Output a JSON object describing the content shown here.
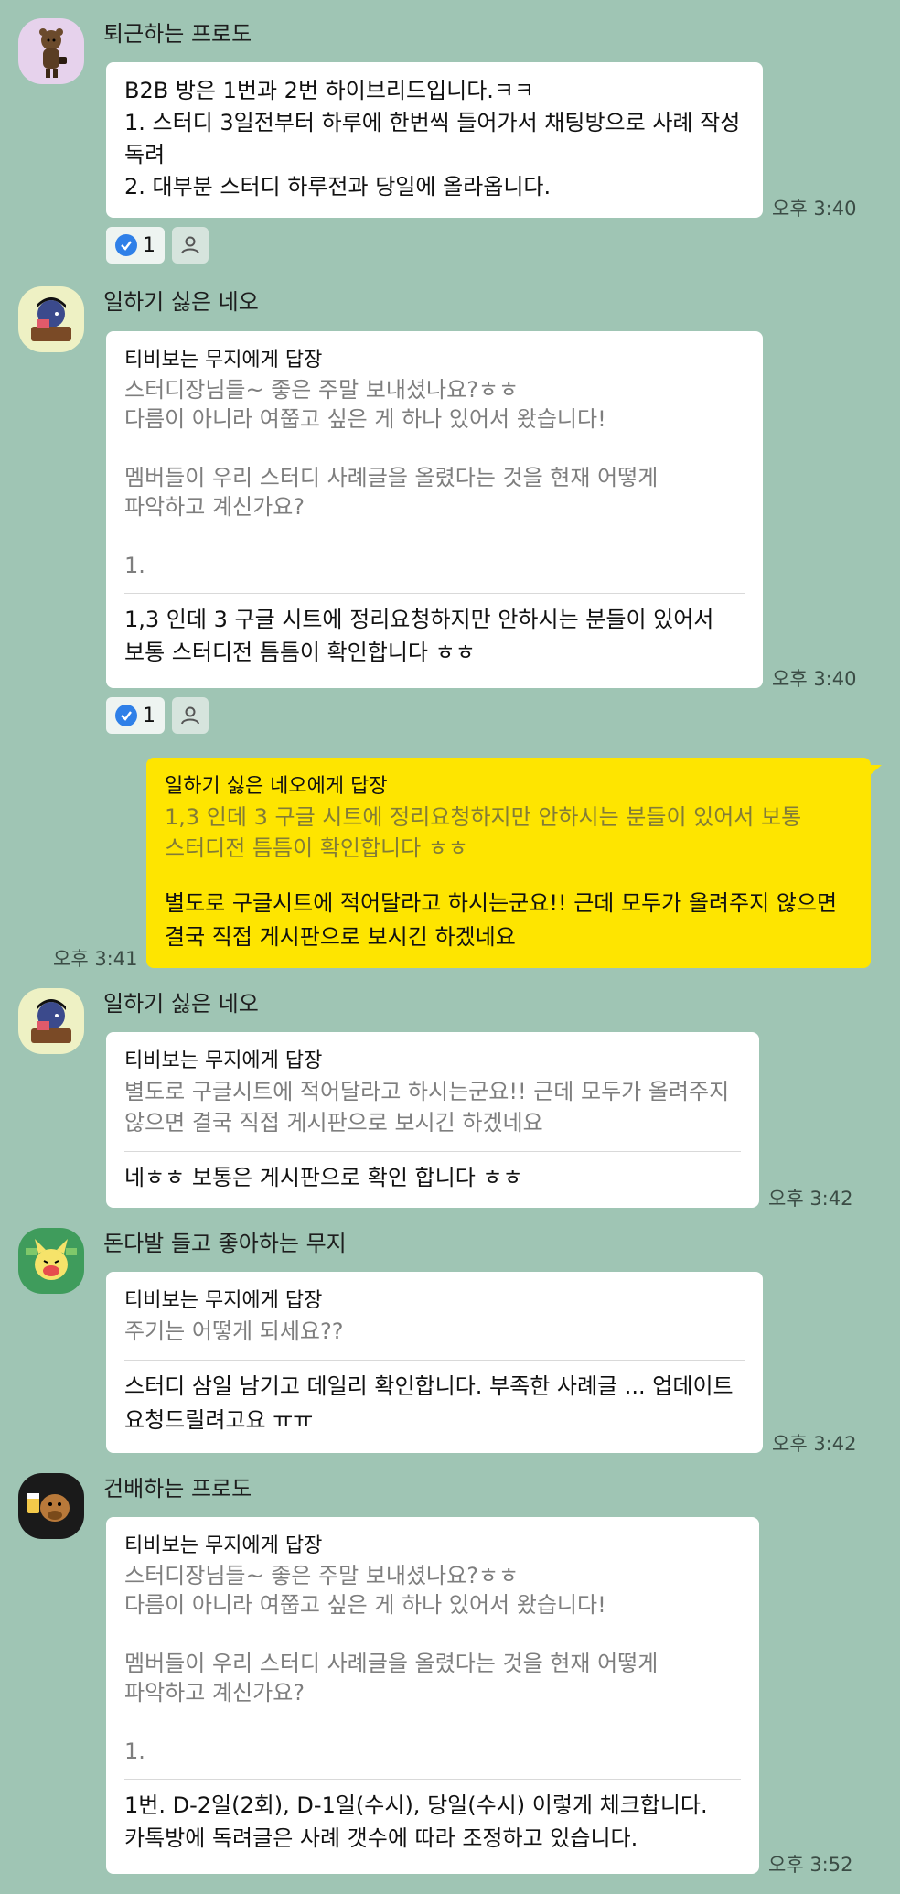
{
  "colors": {
    "background": "#9fc5b4",
    "bubble_other": "#ffffff",
    "bubble_mine": "#fee500",
    "quote_text": "#7e7e7e"
  },
  "messages": [
    {
      "sender": "퇴근하는 프로도",
      "avatar_icon": "bear-character-icon",
      "text": "B2B 방은 1번과 2번 하이브리드입니다.ㅋㅋ\n1. 스터디 3일전부터 하루에 한번씩 들어가서 채팅방으로 사례 작성 독려\n2. 대부분 스터디 하루전과 당일에 올라옵니다.",
      "time": "오후 3:40",
      "reaction_count": "1"
    },
    {
      "sender": "일하기 싫은 네오",
      "avatar_icon": "neo-laptop-character-icon",
      "reply_to": "티비보는 무지에게 답장",
      "quote": "스터디장님들~ 좋은 주말 보내셨나요?ㅎㅎ\n다름이 아니라 여쭙고 싶은 게 하나 있어서 왔습니다!\n\n멤버들이 우리 스터디 사례글을 올렸다는 것을 현재 어떻게 파악하고 계신가요?\n\n1.",
      "text": "1,3 인데 3 구글 시트에 정리요청하지만 안하시는 분들이 있어서 보통 스터디전 틈틈이 확인합니다 ㅎㅎ",
      "time": "오후 3:40",
      "reaction_count": "1"
    },
    {
      "sender": "me",
      "reply_to": "일하기 싫은 네오에게 답장",
      "quote": "1,3 인데 3 구글 시트에 정리요청하지만 안하시는 분들이 있어서 보통 스터디전 틈틈이 확인합니다 ㅎㅎ",
      "text": "별도로 구글시트에 적어달라고 하시는군요!! 근데 모두가 올려주지 않으면 결국 직접 게시판으로 보시긴 하겠네요",
      "time": "오후 3:41"
    },
    {
      "sender": "일하기 싫은 네오",
      "avatar_icon": "neo-laptop-character-icon",
      "reply_to": "티비보는 무지에게 답장",
      "quote": "별도로 구글시트에 적어달라고 하시는군요!! 근데 모두가 올려주지 않으면 결국 직접 게시판으로 보시긴 하겠네요",
      "text": "네ㅎㅎ 보통은 게시판으로 확인 합니다 ㅎㅎ",
      "time": "오후 3:42"
    },
    {
      "sender": "돈다발 들고 좋아하는 무지",
      "avatar_icon": "muzi-money-character-icon",
      "reply_to": "티비보는 무지에게 답장",
      "quote": "주기는 어떻게 되세요??",
      "text": "스터디 삼일 남기고 데일리 확인합니다. 부족한 사례글 ... 업데이트 요청드릴려고요 ㅠㅠ",
      "time": "오후 3:42"
    },
    {
      "sender": "건배하는 프로도",
      "avatar_icon": "frodo-cheers-character-icon",
      "reply_to": "티비보는 무지에게 답장",
      "quote": "스터디장님들~ 좋은 주말 보내셨나요?ㅎㅎ\n다름이 아니라 여쭙고 싶은 게 하나 있어서 왔습니다!\n\n멤버들이 우리 스터디 사례글을 올렸다는 것을 현재 어떻게 파악하고 계신가요?\n\n1.",
      "text": "1번. D-2일(2회), D-1일(수시), 당일(수시) 이렇게 체크합니다. 카톡방에 독려글은 사례 갯수에 따라 조정하고 있습니다.",
      "time": "오후 3:52"
    }
  ]
}
